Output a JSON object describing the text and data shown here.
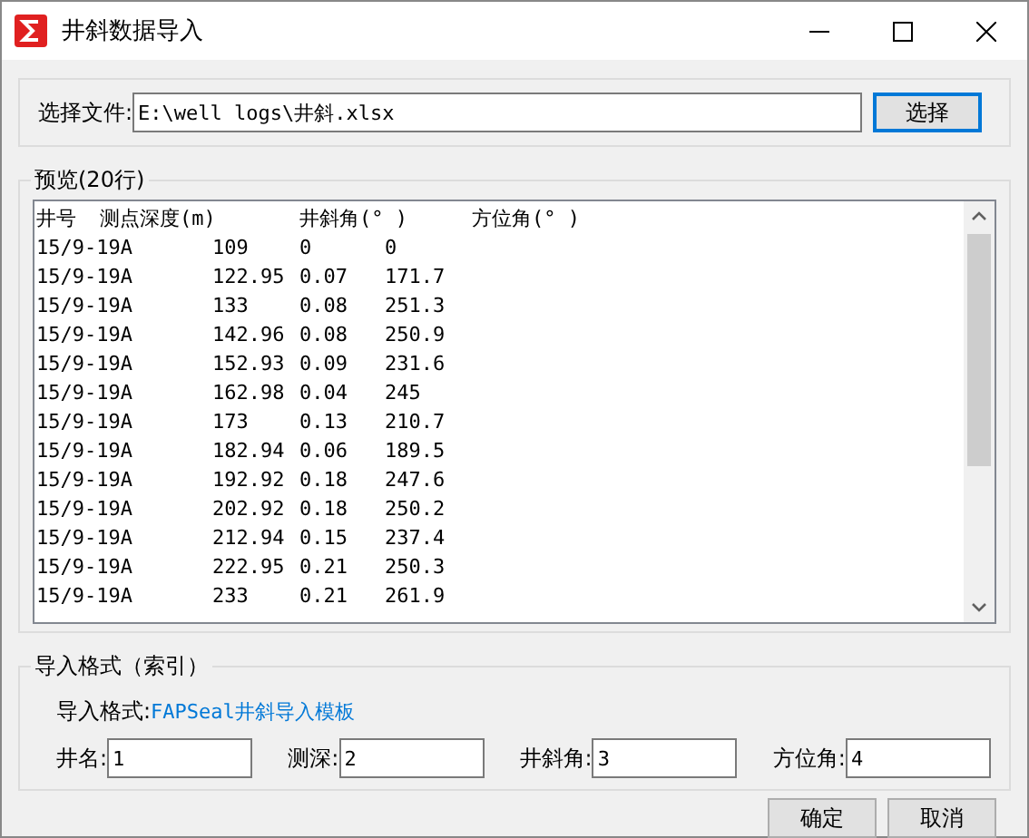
{
  "window": {
    "title": "井斜数据导入"
  },
  "file": {
    "label": "选择文件:",
    "value": "E:\\well logs\\井斜.xlsx",
    "button": "选择"
  },
  "preview": {
    "title": "预览(20行)",
    "headers": [
      "井号",
      "测点深度(m)",
      "井斜角(° )",
      "方位角(° )"
    ],
    "rows": [
      [
        "15/9-19A",
        "109",
        "0",
        "0"
      ],
      [
        "15/9-19A",
        "122.95",
        "0.07",
        "171.7"
      ],
      [
        "15/9-19A",
        "133",
        "0.08",
        "251.3"
      ],
      [
        "15/9-19A",
        "142.96",
        "0.08",
        "250.9"
      ],
      [
        "15/9-19A",
        "152.93",
        "0.09",
        "231.6"
      ],
      [
        "15/9-19A",
        "162.98",
        "0.04",
        "245"
      ],
      [
        "15/9-19A",
        "173",
        "0.13",
        "210.7"
      ],
      [
        "15/9-19A",
        "182.94",
        "0.06",
        "189.5"
      ],
      [
        "15/9-19A",
        "192.92",
        "0.18",
        "247.6"
      ],
      [
        "15/9-19A",
        "202.92",
        "0.18",
        "250.2"
      ],
      [
        "15/9-19A",
        "212.94",
        "0.15",
        "237.4"
      ],
      [
        "15/9-19A",
        "222.95",
        "0.21",
        "250.3"
      ],
      [
        "15/9-19A",
        "233",
        "0.21",
        "261.9"
      ]
    ]
  },
  "format": {
    "title": "导入格式（索引）",
    "label": "导入格式:",
    "template": "FAPSeal井斜导入模板",
    "fields": [
      {
        "label": "井名:",
        "value": "1"
      },
      {
        "label": "测深:",
        "value": "2"
      },
      {
        "label": "井斜角:",
        "value": "3"
      },
      {
        "label": "方位角:",
        "value": "4"
      }
    ]
  },
  "buttons": [
    "确定",
    "取消"
  ]
}
